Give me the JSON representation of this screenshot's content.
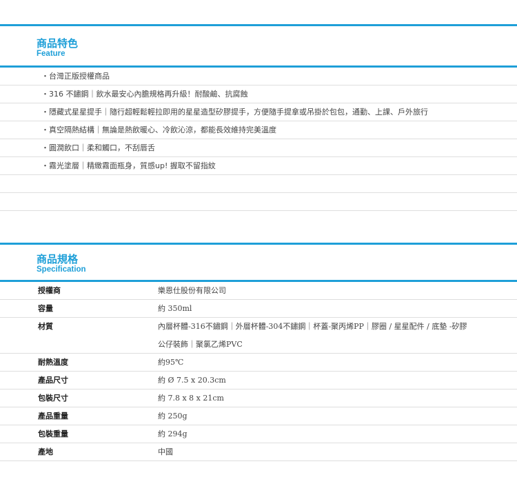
{
  "feature": {
    "title_zh": "商品特色",
    "title_en": "Feature",
    "items": [
      "・台灣正版授權商品",
      "・316 不鏽鋼｜飲水最安心內膽規格再升級！耐酸鹼、抗腐蝕",
      "・隱藏式星星提手｜隨行超輕鬆輕拉即用的星星造型矽膠提手，方便隨手提拿或吊掛於包包，通勤、上課、戶外旅行",
      "・真空隔熱結構｜無論是熱飲暖心、冷飲沁涼，都能長效維持完美溫度",
      "・圓潤飲口｜柔和觸口，不刮唇舌",
      "・霧光塗層｜精緻霧面瓶身，質感up! 握取不留指紋",
      "",
      ""
    ]
  },
  "spec": {
    "title_zh": "商品規格",
    "title_en": "Specification",
    "rows": [
      {
        "label": "授權商",
        "value": "樂恩仕股份有限公司"
      },
      {
        "label": "容量",
        "value": "約 350ml"
      },
      {
        "label": "材質",
        "value": "內層杯體-316不鏽鋼｜外層杯體-304不鏽鋼｜杯蓋-聚丙烯PP｜膠圈 / 星星配件 / 底墊 -矽膠"
      },
      {
        "label": "",
        "value": "公仔裝飾｜聚氯乙烯PVC"
      },
      {
        "label": "耐熱溫度",
        "value": "約95℃"
      },
      {
        "label": "產品尺寸",
        "value": "約 Ø 7.5 x 20.3cm"
      },
      {
        "label": "包裝尺寸",
        "value": "約 7.8 x 8 x 21cm"
      },
      {
        "label": "產品重量",
        "value": "約 250g"
      },
      {
        "label": "包裝重量",
        "value": "約 294g"
      },
      {
        "label": "產地",
        "value": "中國"
      }
    ]
  },
  "colors": {
    "accent": "#1e9fd8",
    "divider": "#dedede"
  }
}
